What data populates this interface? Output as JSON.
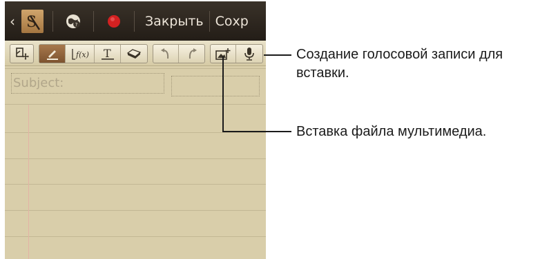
{
  "action_bar": {
    "back_icon": "back-chevron-icon",
    "app_icon": "s-note-icon",
    "map_icon": "location-globe-icon",
    "record_icon": "record-icon",
    "record_color": "#d32121",
    "close_label": "Закрыть",
    "save_label": "Сохр"
  },
  "toolbar": {
    "icons": [
      "template-move-icon",
      "pen-icon",
      "formula-icon",
      "text-icon",
      "eraser-icon",
      "undo-icon",
      "redo-icon",
      "insert-image-icon",
      "voice-record-icon"
    ],
    "formula_label": "f(x)",
    "text_tool_label": "T"
  },
  "note": {
    "subject_placeholder": "Subject:",
    "date_value": ""
  },
  "callouts": {
    "voice": "Создание голосовой записи для вставки.",
    "media": "Вставка файла мультимедиа."
  },
  "colors": {
    "paper": "#d9ceaa",
    "action_bar": "#2b241d",
    "active_tool": "#8e6239",
    "margin_line": "#e3b3a5"
  }
}
